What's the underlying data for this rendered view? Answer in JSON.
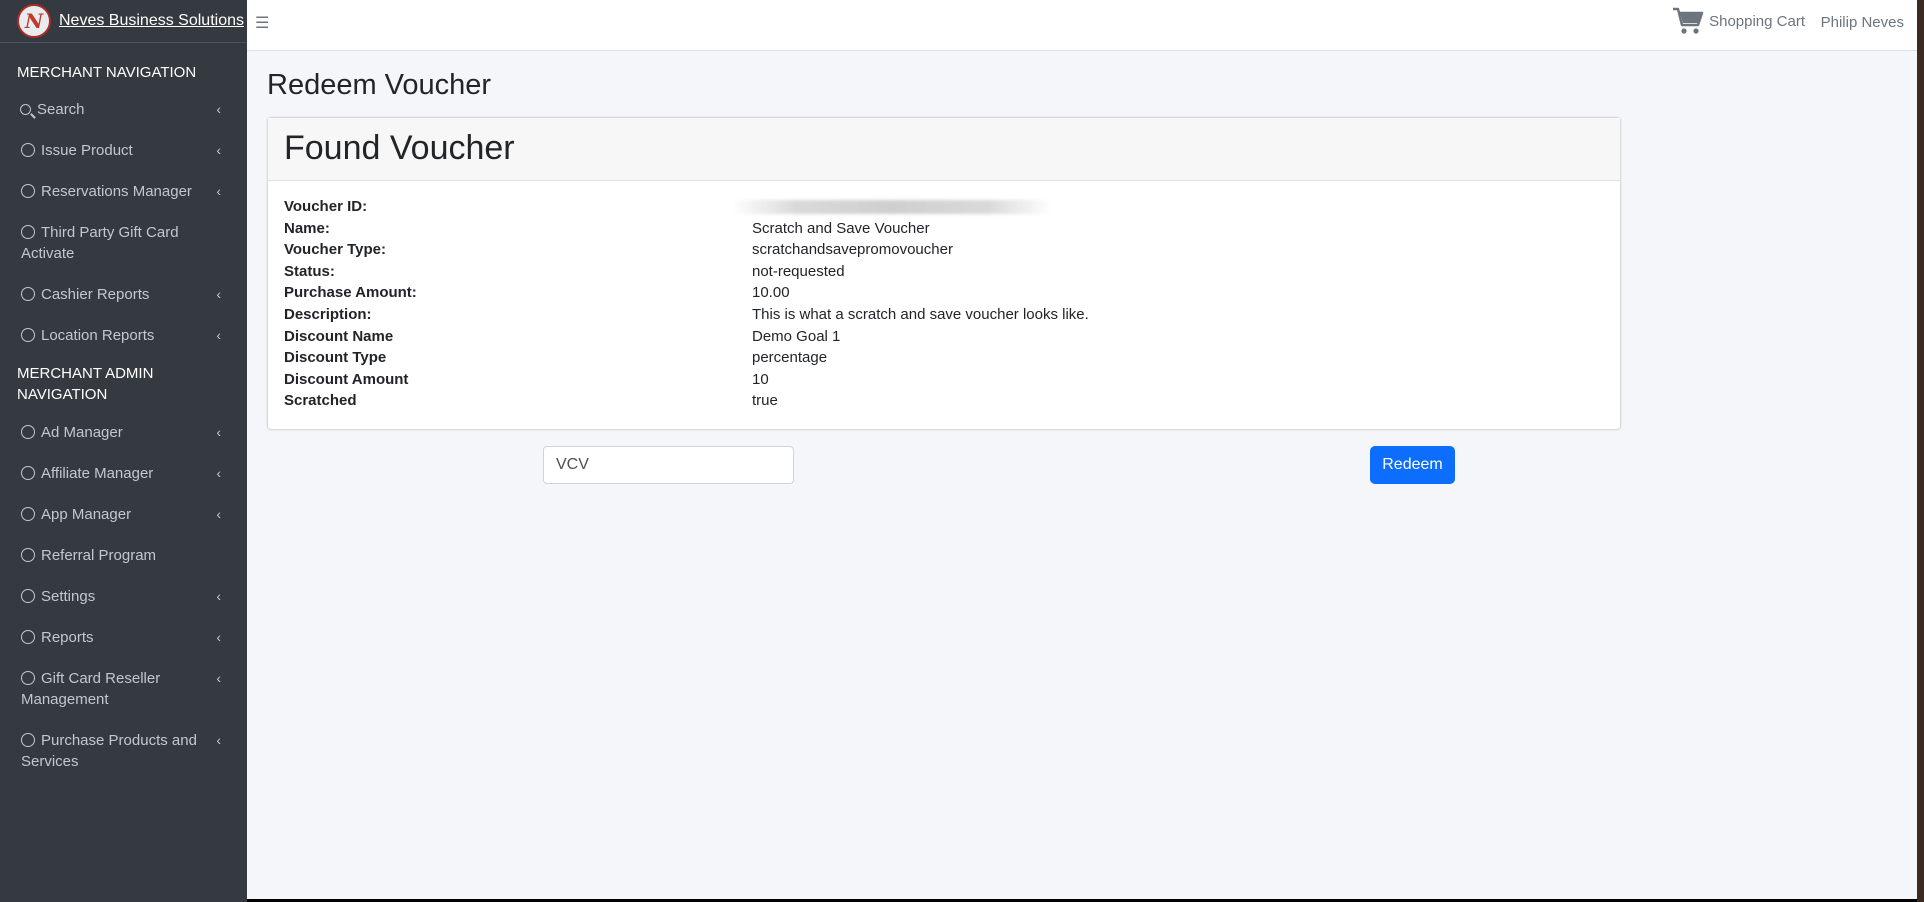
{
  "brand": {
    "logo_letter": "N",
    "name": "Neves Business Solutions"
  },
  "topbar": {
    "cart_label": "Shopping Cart",
    "user_name": "Philip Neves"
  },
  "sidebar": {
    "header1": "MERCHANT NAVIGATION",
    "search_label": "Search",
    "items1": [
      {
        "label": "Issue Product"
      },
      {
        "label": "Reservations Manager"
      },
      {
        "label": "Third Party Gift Card Activate"
      },
      {
        "label": "Cashier Reports"
      },
      {
        "label": "Location Reports"
      }
    ],
    "header2": "MERCHANT ADMIN NAVIGATION",
    "items2": [
      {
        "label": "Ad Manager"
      },
      {
        "label": "Affiliate Manager"
      },
      {
        "label": "App Manager"
      },
      {
        "label": "Referral Program"
      },
      {
        "label": "Settings"
      },
      {
        "label": "Reports"
      },
      {
        "label": "Gift Card Reseller Management"
      },
      {
        "label": "Purchase Products and Services"
      }
    ]
  },
  "page": {
    "title": "Redeem Voucher"
  },
  "card": {
    "title": "Found Voucher",
    "rows": [
      {
        "label": "Voucher ID:",
        "value": ""
      },
      {
        "label": "Name:",
        "value": "Scratch and Save Voucher"
      },
      {
        "label": "Voucher Type:",
        "value": "scratchandsavepromovoucher"
      },
      {
        "label": "Status:",
        "value": "not-requested"
      },
      {
        "label": "Purchase Amount:",
        "value": "10.00"
      },
      {
        "label": "Description:",
        "value": "This is what a scratch and save voucher looks like."
      },
      {
        "label": "Discount Name",
        "value": "Demo Goal 1"
      },
      {
        "label": "Discount Type",
        "value": "percentage"
      },
      {
        "label": "Discount Amount",
        "value": "10"
      },
      {
        "label": "Scratched",
        "value": "true"
      }
    ]
  },
  "form": {
    "voucher_value": "VCV",
    "redeem_label": "Redeem"
  },
  "colors": {
    "sidebar_bg": "#343a40",
    "primary": "#0d6efd",
    "content_bg": "#f4f6f9"
  }
}
